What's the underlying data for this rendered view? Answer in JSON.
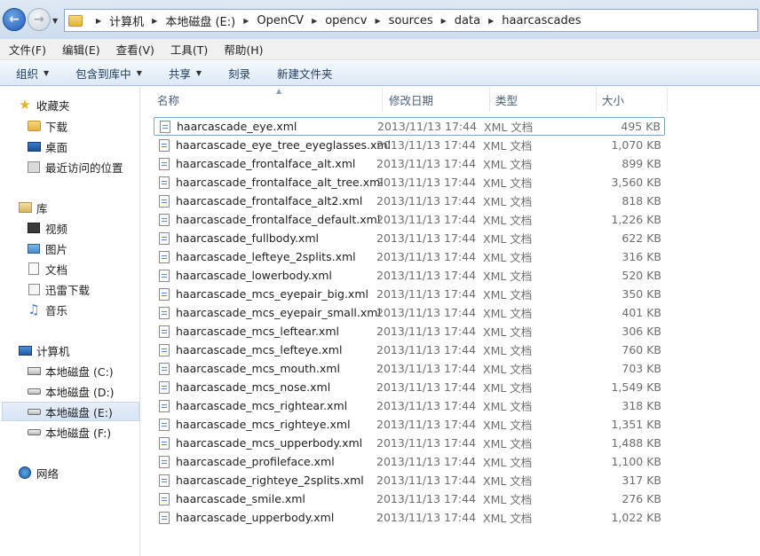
{
  "address": {
    "crumbs": [
      "计算机",
      "本地磁盘 (E:)",
      "OpenCV",
      "opencv",
      "sources",
      "data",
      "haarcascades"
    ]
  },
  "menu": [
    "文件(F)",
    "编辑(E)",
    "查看(V)",
    "工具(T)",
    "帮助(H)"
  ],
  "toolbar": {
    "organize": "组织",
    "include_library": "包含到库中",
    "share": "共享",
    "burn": "刻录",
    "new_folder": "新建文件夹"
  },
  "sidebar": {
    "favorites": "收藏夹",
    "downloads": "下载",
    "desktop": "桌面",
    "recent": "最近访问的位置",
    "libraries": "库",
    "videos": "视频",
    "pictures": "图片",
    "documents": "文档",
    "xunlei": "迅雷下载",
    "music": "音乐",
    "computer": "计算机",
    "drive_c": "本地磁盘 (C:)",
    "drive_d": "本地磁盘 (D:)",
    "drive_e": "本地磁盘 (E:)",
    "drive_f": "本地磁盘 (F:)",
    "network": "网络"
  },
  "columns": {
    "name": "名称",
    "date": "修改日期",
    "type": "类型",
    "size": "大小"
  },
  "files": [
    {
      "name": "haarcascade_eye.xml",
      "date": "2013/11/13 17:44",
      "type": "XML 文档",
      "size": "495 KB"
    },
    {
      "name": "haarcascade_eye_tree_eyeglasses.xml",
      "date": "2013/11/13 17:44",
      "type": "XML 文档",
      "size": "1,070 KB"
    },
    {
      "name": "haarcascade_frontalface_alt.xml",
      "date": "2013/11/13 17:44",
      "type": "XML 文档",
      "size": "899 KB"
    },
    {
      "name": "haarcascade_frontalface_alt_tree.xml",
      "date": "2013/11/13 17:44",
      "type": "XML 文档",
      "size": "3,560 KB"
    },
    {
      "name": "haarcascade_frontalface_alt2.xml",
      "date": "2013/11/13 17:44",
      "type": "XML 文档",
      "size": "818 KB"
    },
    {
      "name": "haarcascade_frontalface_default.xml",
      "date": "2013/11/13 17:44",
      "type": "XML 文档",
      "size": "1,226 KB"
    },
    {
      "name": "haarcascade_fullbody.xml",
      "date": "2013/11/13 17:44",
      "type": "XML 文档",
      "size": "622 KB"
    },
    {
      "name": "haarcascade_lefteye_2splits.xml",
      "date": "2013/11/13 17:44",
      "type": "XML 文档",
      "size": "316 KB"
    },
    {
      "name": "haarcascade_lowerbody.xml",
      "date": "2013/11/13 17:44",
      "type": "XML 文档",
      "size": "520 KB"
    },
    {
      "name": "haarcascade_mcs_eyepair_big.xml",
      "date": "2013/11/13 17:44",
      "type": "XML 文档",
      "size": "350 KB"
    },
    {
      "name": "haarcascade_mcs_eyepair_small.xml",
      "date": "2013/11/13 17:44",
      "type": "XML 文档",
      "size": "401 KB"
    },
    {
      "name": "haarcascade_mcs_leftear.xml",
      "date": "2013/11/13 17:44",
      "type": "XML 文档",
      "size": "306 KB"
    },
    {
      "name": "haarcascade_mcs_lefteye.xml",
      "date": "2013/11/13 17:44",
      "type": "XML 文档",
      "size": "760 KB"
    },
    {
      "name": "haarcascade_mcs_mouth.xml",
      "date": "2013/11/13 17:44",
      "type": "XML 文档",
      "size": "703 KB"
    },
    {
      "name": "haarcascade_mcs_nose.xml",
      "date": "2013/11/13 17:44",
      "type": "XML 文档",
      "size": "1,549 KB"
    },
    {
      "name": "haarcascade_mcs_rightear.xml",
      "date": "2013/11/13 17:44",
      "type": "XML 文档",
      "size": "318 KB"
    },
    {
      "name": "haarcascade_mcs_righteye.xml",
      "date": "2013/11/13 17:44",
      "type": "XML 文档",
      "size": "1,351 KB"
    },
    {
      "name": "haarcascade_mcs_upperbody.xml",
      "date": "2013/11/13 17:44",
      "type": "XML 文档",
      "size": "1,488 KB"
    },
    {
      "name": "haarcascade_profileface.xml",
      "date": "2013/11/13 17:44",
      "type": "XML 文档",
      "size": "1,100 KB"
    },
    {
      "name": "haarcascade_righteye_2splits.xml",
      "date": "2013/11/13 17:44",
      "type": "XML 文档",
      "size": "317 KB"
    },
    {
      "name": "haarcascade_smile.xml",
      "date": "2013/11/13 17:44",
      "type": "XML 文档",
      "size": "276 KB"
    },
    {
      "name": "haarcascade_upperbody.xml",
      "date": "2013/11/13 17:44",
      "type": "XML 文档",
      "size": "1,022 KB"
    }
  ]
}
